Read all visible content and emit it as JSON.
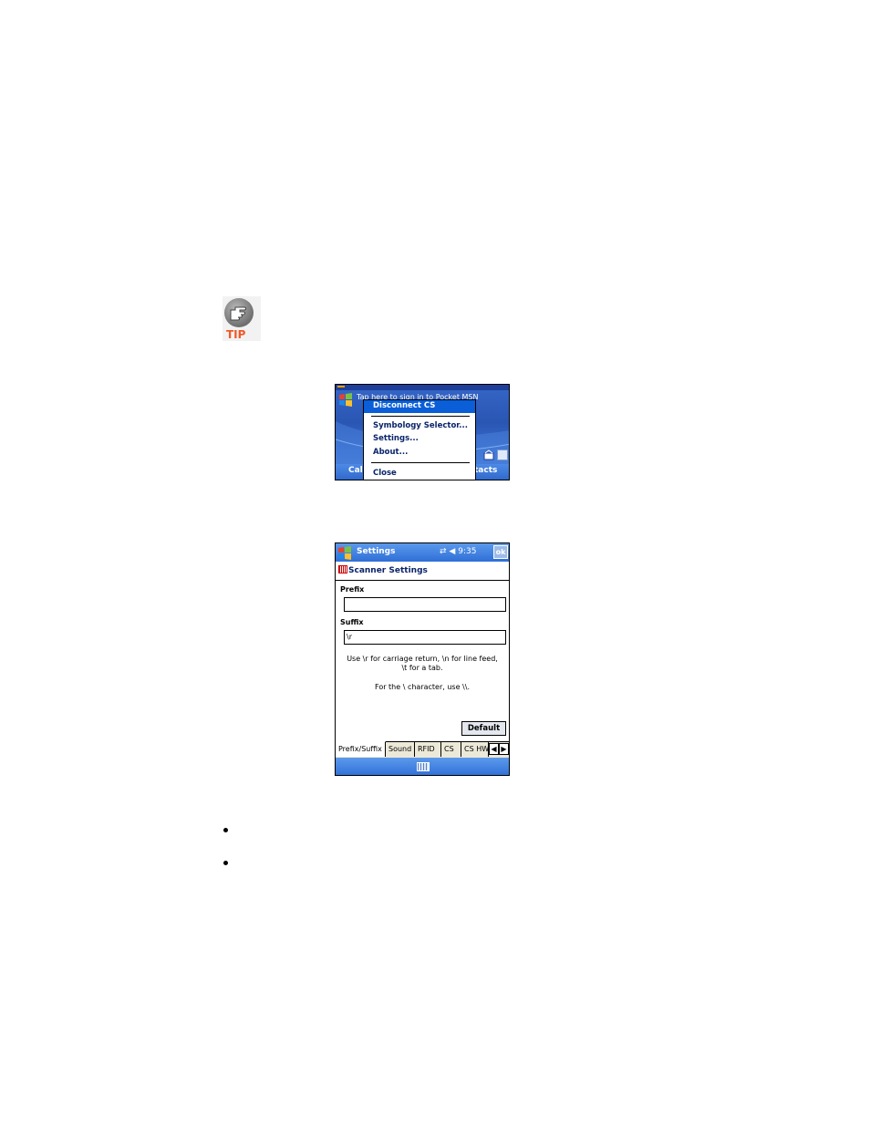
{
  "tip": {
    "label": "TIP"
  },
  "today_screen": {
    "banner_text": "Tap here to sign in to Pocket MSN",
    "softkey_left": "Cal",
    "softkey_right": "tacts",
    "context_menu": {
      "items": [
        {
          "label": "Disconnect CS",
          "selected": true
        },
        {
          "label": "Symbology Selector..."
        },
        {
          "label": "Settings..."
        },
        {
          "label": "About..."
        },
        {
          "label": "Close"
        }
      ]
    }
  },
  "settings_screen": {
    "title": "Settings",
    "time": "9:35",
    "ok_label": "ok",
    "header": "Scanner Settings",
    "prefix_label": "Prefix",
    "prefix_value": "",
    "suffix_label": "Suffix",
    "suffix_value": "\\r",
    "hint_line1": "Use \\r for carriage return, \\n for line feed, \\t for a tab.",
    "hint_line2": "For the \\ character, use \\\\.",
    "default_button": "Default",
    "tabs": [
      "Prefix/Suffix",
      "Sound",
      "RFID",
      "CS",
      "CS HW"
    ],
    "active_tab": "Prefix/Suffix",
    "arrow_left": "◀",
    "arrow_right": "▶"
  }
}
